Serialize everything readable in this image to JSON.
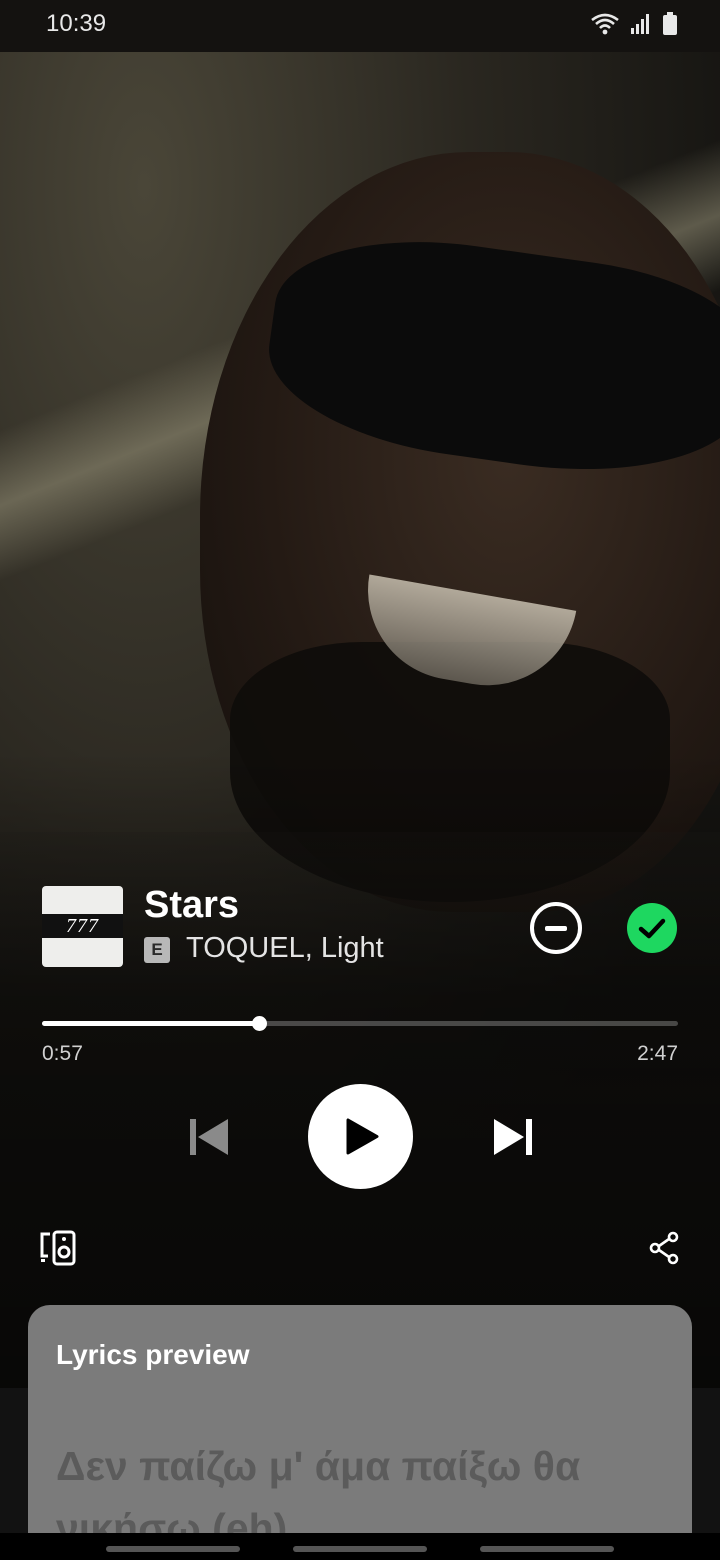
{
  "status_bar": {
    "time": "10:39",
    "icons": [
      "wifi-icon",
      "signal-icon",
      "battery-icon"
    ]
  },
  "track": {
    "cover_text": "777",
    "title": "Stars",
    "explicit_badge": "E",
    "artists": "TOQUEL, Light",
    "liked": true
  },
  "playback": {
    "elapsed": "0:57",
    "total": "2:47",
    "progress_fraction": 0.341,
    "is_playing": false
  },
  "controls": {
    "icons": [
      "previous-icon",
      "play-icon",
      "next-icon",
      "devices-icon",
      "share-icon"
    ]
  },
  "lyrics": {
    "title": "Lyrics preview",
    "line": "Δεν παίζω μ' άμα παίξω θα νικήσω (eh)"
  },
  "colors": {
    "accent_green": "#1ed760",
    "lyrics_card": "#7b7b7b"
  }
}
